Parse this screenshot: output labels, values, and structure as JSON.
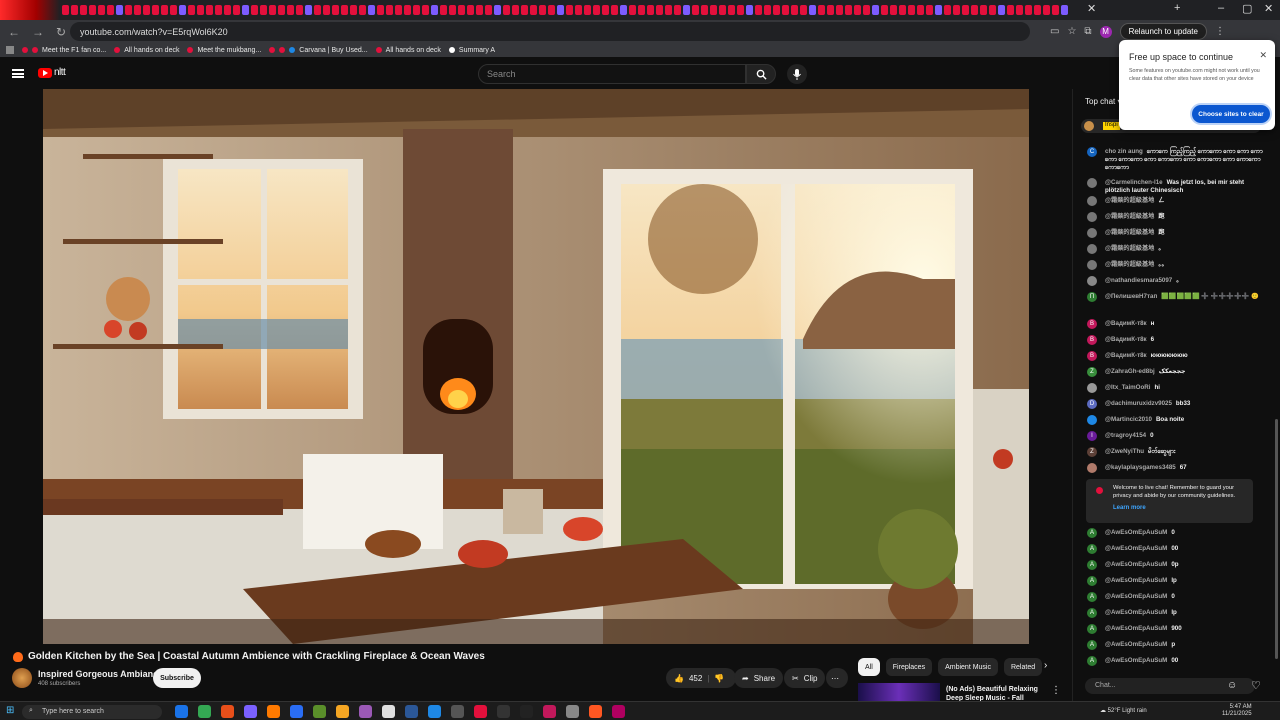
{
  "browser": {
    "url": "youtube.com/watch?v=E5rqWol6K20",
    "relaunch_label": "Relaunch to update",
    "profile_initial": "M",
    "bookmarks": [
      "Meet the F1 fan co...",
      "All hands on deck",
      "Meet the mukbang...",
      "Carvana | Buy Used...",
      "All hands on deck",
      "Summary A"
    ]
  },
  "youtube": {
    "search_placeholder": "Search",
    "logo_suffix": "nltt"
  },
  "video": {
    "title": "Golden Kitchen by the Sea | Coastal Autumn Ambience with Crackling Fireplace & Ocean Waves",
    "channel": "Inspired Gorgeous Ambiance",
    "subscribers": "408 subscribers",
    "subscribe_label": "Subscribe",
    "likes": "452",
    "share_label": "Share",
    "clip_label": "Clip"
  },
  "related": {
    "chips": [
      "All",
      "Fireplaces",
      "Ambient Music",
      "Related"
    ],
    "first_title": "(No Ads) Beautiful Relaxing Deep Sleep Music - Fall Asleep"
  },
  "chat": {
    "header": "Top chat",
    "pinned_tag": "Inspi",
    "messages": [
      {
        "author": "cho zin aung",
        "text": "ကောကေ ကြည့်ကြည့် ကောကော ကော ကော ကောကော ကောကော ကော ကောကော ကော ကောကော ကော ကောကော ကောကော",
        "avatar": "C",
        "color": "#1565c0"
      },
      {
        "author": "@Carmelinchen-l1e",
        "text": "Was jetzt los, bei mir steht plötzlich lauter Chinesisch",
        "avatar": "",
        "color": "#777"
      },
      {
        "author": "@霜燚的超級基地",
        "text": "ㄥ",
        "avatar": "",
        "color": "#777"
      },
      {
        "author": "@霜燚的超級基地",
        "text": "跑",
        "avatar": "",
        "color": "#777"
      },
      {
        "author": "@霜燚的超級基地",
        "text": "跑",
        "avatar": "",
        "color": "#777"
      },
      {
        "author": "@霜燚的超級基地",
        "text": "。",
        "avatar": "",
        "color": "#777"
      },
      {
        "author": "@霜燚的超級基地",
        "text": "。。",
        "avatar": "",
        "color": "#777"
      },
      {
        "author": "@nathandiesmara5097",
        "text": "。",
        "avatar": "",
        "color": "#888"
      },
      {
        "author": "@ПелишевН7тап",
        "text": "🟩🟩🟩🟩🟩 ➕ ➕➕➕➕➕ 🙂",
        "avatar": "П",
        "color": "#2e7d32"
      },
      {
        "author": "@ВадимК-т8к",
        "text": "н",
        "avatar": "B",
        "color": "#c2185b"
      },
      {
        "author": "@ВадимК-т8к",
        "text": "6",
        "avatar": "B",
        "color": "#c2185b"
      },
      {
        "author": "@ВадимК-т8к",
        "text": "ююююююю",
        "avatar": "B",
        "color": "#c2185b"
      },
      {
        "author": "@ZahraGh-ed8bj",
        "text": "جججعکک",
        "avatar": "Z",
        "color": "#388e3c"
      },
      {
        "author": "@Itx_TaimOoRi",
        "text": "hi",
        "avatar": "",
        "color": "#999"
      },
      {
        "author": "@dachimuruxidzv9025",
        "text": "bb33",
        "avatar": "D",
        "color": "#5c6bc0"
      },
      {
        "author": "@Martincic2010",
        "text": "Boa noite",
        "avatar": "",
        "color": "#1e88e5"
      },
      {
        "author": "@tragroy4154",
        "text": "0",
        "avatar": "I",
        "color": "#6a1b9a"
      },
      {
        "author": "@ZweNyiThu",
        "text": "မိတ်ဆွေများ",
        "avatar": "Z",
        "color": "#5d4037"
      },
      {
        "author": "@kaylaplaysgames3485",
        "text": "67",
        "avatar": "",
        "color": "#b07a6a"
      }
    ],
    "welcome_text": "Welcome to live chat! Remember to guard your privacy and abide by our community guidelines.",
    "learn_more": "Learn more",
    "messages2": [
      {
        "author": "@AwEsOmEpAuSuM",
        "text": "0"
      },
      {
        "author": "@AwEsOmEpAuSuM",
        "text": "00"
      },
      {
        "author": "@AwEsOmEpAuSuM",
        "text": "0p"
      },
      {
        "author": "@AwEsOmEpAuSuM",
        "text": "lp"
      },
      {
        "author": "@AwEsOmEpAuSuM",
        "text": "0"
      },
      {
        "author": "@AwEsOmEpAuSuM",
        "text": "lp"
      },
      {
        "author": "@AwEsOmEpAuSuM",
        "text": "900"
      },
      {
        "author": "@AwEsOmEpAuSuM",
        "text": "p"
      },
      {
        "author": "@AwEsOmEpAuSuM",
        "text": "00"
      }
    ],
    "input_placeholder": "Chat..."
  },
  "popup": {
    "title": "Free up space to continue",
    "body": "Some features on youtube.com might not work until you clear data that other sites have stored on your device",
    "button": "Choose sites to clear"
  },
  "taskbar": {
    "search_placeholder": "Type here to search",
    "weather": "52°F Light rain",
    "time": "5:47 AM",
    "date": "11/21/2025"
  }
}
